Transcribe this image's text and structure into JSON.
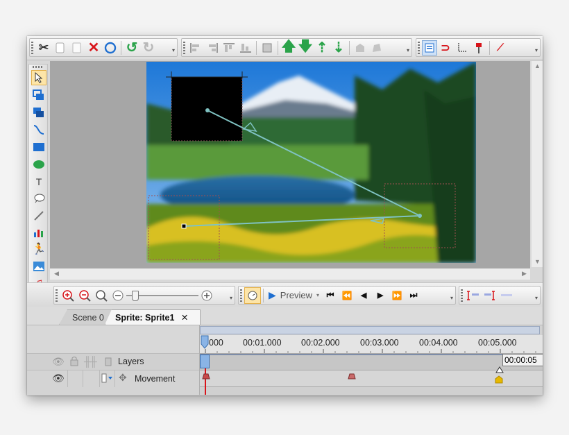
{
  "toolbar": {
    "icons": [
      "cut-icon",
      "copy-icon",
      "paste-icon",
      "delete-icon",
      "circle-icon",
      "undo-icon",
      "redo-icon",
      "align-left-icon",
      "align-right-icon",
      "align-top-icon",
      "align-bottom-icon",
      "group-icon",
      "move-up-icon",
      "move-down-icon",
      "bring-front-icon",
      "send-back-icon",
      "shape-a-icon",
      "shape-b-icon",
      "properties-icon",
      "magnet-icon",
      "crop-icon",
      "pin-icon",
      "tool-icon"
    ]
  },
  "left_tools": [
    "select-arrow-icon",
    "rectangle-copy-icon",
    "layer-icon",
    "curve-icon",
    "rectangle-icon",
    "ellipse-icon",
    "text-icon",
    "callout-icon",
    "brush-icon",
    "chart-icon",
    "walker-icon",
    "image-icon",
    "music-icon",
    "film-icon",
    "move-icon"
  ],
  "playbar": {
    "preview_label": "Preview"
  },
  "tabs": {
    "scene": "Scene 0",
    "sprite": "Sprite: Sprite1",
    "close": "✕"
  },
  "timeline": {
    "layers_label": "Layers",
    "movement_label": "Movement",
    "ticks": [
      "000",
      "00:01.000",
      "00:02.000",
      "00:03.000",
      "00:04.000",
      "00:05.000"
    ],
    "end_time": "00:00:05"
  },
  "colors": {
    "accent_blue": "#1f6fd0",
    "red": "#d8141a",
    "green": "#2aa34a",
    "keyframe_red": "#c94a4a",
    "keyframe_gold": "#e6b800"
  }
}
